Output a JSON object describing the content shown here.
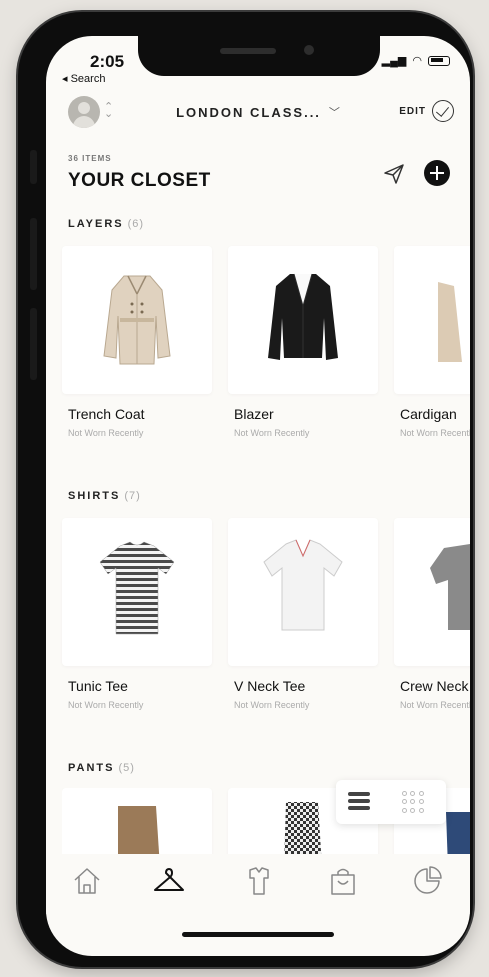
{
  "status": {
    "time": "2:05",
    "back_label": "◂ Search"
  },
  "header": {
    "closet_name": "LONDON CLASS...",
    "edit_label": "EDIT",
    "items_count": "36 ITEMS",
    "title": "YOUR CLOSET"
  },
  "sections": [
    {
      "title": "LAYERS",
      "count": "(6)",
      "items": [
        {
          "name": "Trench Coat",
          "status": "Not Worn Recently"
        },
        {
          "name": "Blazer",
          "status": "Not Worn Recently"
        },
        {
          "name": "Cardigan",
          "status": "Not Worn Recently"
        }
      ]
    },
    {
      "title": "SHIRTS",
      "count": "(7)",
      "items": [
        {
          "name": "Tunic Tee",
          "status": "Not Worn Recently"
        },
        {
          "name": "V Neck Tee",
          "status": "Not Worn Recently"
        },
        {
          "name": "Crew Neck",
          "status": "Not Worn Recently"
        }
      ]
    },
    {
      "title": "PANTS",
      "count": "(5)",
      "items": []
    }
  ],
  "bottom_nav": [
    "home-icon",
    "hanger-icon",
    "outfits-icon",
    "shopping-bag-icon",
    "stats-icon"
  ],
  "colors": {
    "background": "#fbfaf7",
    "accent": "#111111"
  }
}
